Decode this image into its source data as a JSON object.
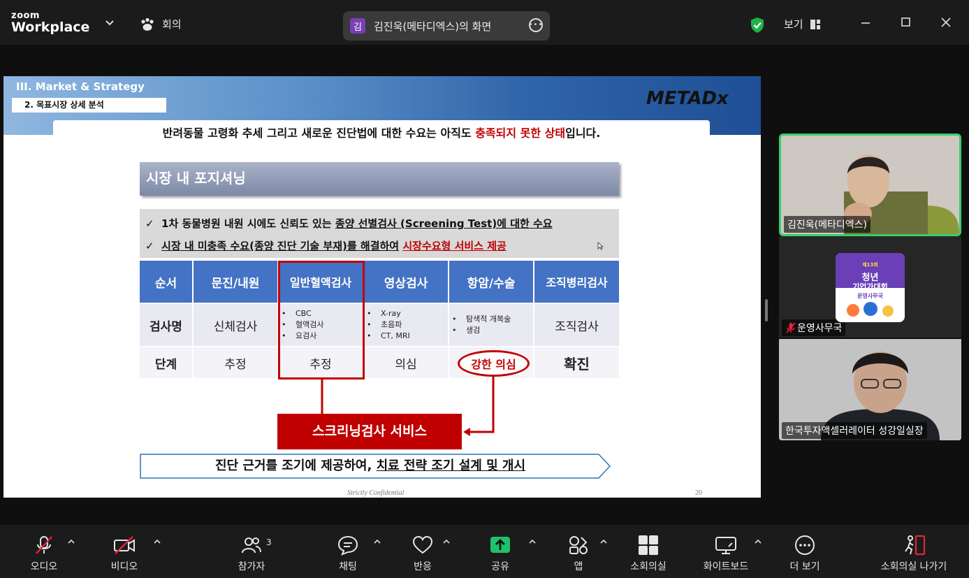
{
  "topbar": {
    "brand_line1": "zoom",
    "brand_line2": "Workplace",
    "meeting_label": "회의",
    "share_initial": "김",
    "share_label": "김진욱(메타디엑스)의 화면",
    "view_label": "보기"
  },
  "slide": {
    "section": "III. Market & Strategy",
    "subsection": "2. 목표시장 상세 분석",
    "logo_text": "METADx",
    "headline_pre": "반려동물 고령화 추세 그리고 새로운 진단법에 대한 수요는 아직도 ",
    "headline_highlight": "충족되지 못한 상태",
    "headline_post": "입니다.",
    "section_title": "시장 내 포지셔닝",
    "bullet1_pre": "1차 동물병원 내원 시에도 신뢰도 있는 ",
    "bullet1_underline": "종양 선별검사 (Screening Test)에 대한 수요",
    "bullet2_underline": "시장 내 미충족 수요(종양 진단 기술 부재)를 해결하여",
    "bullet2_red": "시장수요형 서비스 제공",
    "check": "✓",
    "table": {
      "headers": [
        "순서",
        "문진/내원",
        "일반혈액검사",
        "영상검사",
        "항암/수술",
        "조직병리검사"
      ],
      "row_name_label": "검사명",
      "row_name": {
        "c1": "신체검사",
        "c2": [
          "CBC",
          "혈액검사",
          "요검사"
        ],
        "c3": [
          "X-ray",
          "초음파",
          "CT, MRI"
        ],
        "c4": [
          "탐색적 개복술",
          "생검"
        ],
        "c5": "조직검사"
      },
      "row_stage_label": "단계",
      "row_stage": [
        "추정",
        "추정",
        "의심",
        "강한 의심",
        "확진"
      ]
    },
    "service_label": "스크리닝검사 서비스",
    "bottom_pre": "진단 근거를 조기에 제공하여, ",
    "bottom_underline": "치료 전략 조기 설계 및 개시",
    "confidential": "Strictly Confidential",
    "page_number": "20"
  },
  "participants": [
    {
      "name": "김진욱(메타디엑스)"
    },
    {
      "name": "운영사무국"
    },
    {
      "name": "한국투자액셀러레이터 성강일실장"
    }
  ],
  "poster": {
    "line1": "제13회",
    "line2": "청년",
    "line3": "기업가대회",
    "line4": "운영사무국"
  },
  "toolbar": {
    "audio": "오디오",
    "video": "비디오",
    "participants": "참가자",
    "participants_count": "3",
    "chat": "채팅",
    "reactions": "반응",
    "share": "공유",
    "apps": "앱",
    "breakout": "소회의실",
    "whiteboard": "화이트보드",
    "more": "더 보기",
    "leave_breakout": "소회의실 나가기"
  },
  "colors": {
    "accent_green": "#34d06c",
    "share_green": "#1fc16b",
    "slide_red": "#c00000",
    "table_blue": "#4472c4"
  }
}
